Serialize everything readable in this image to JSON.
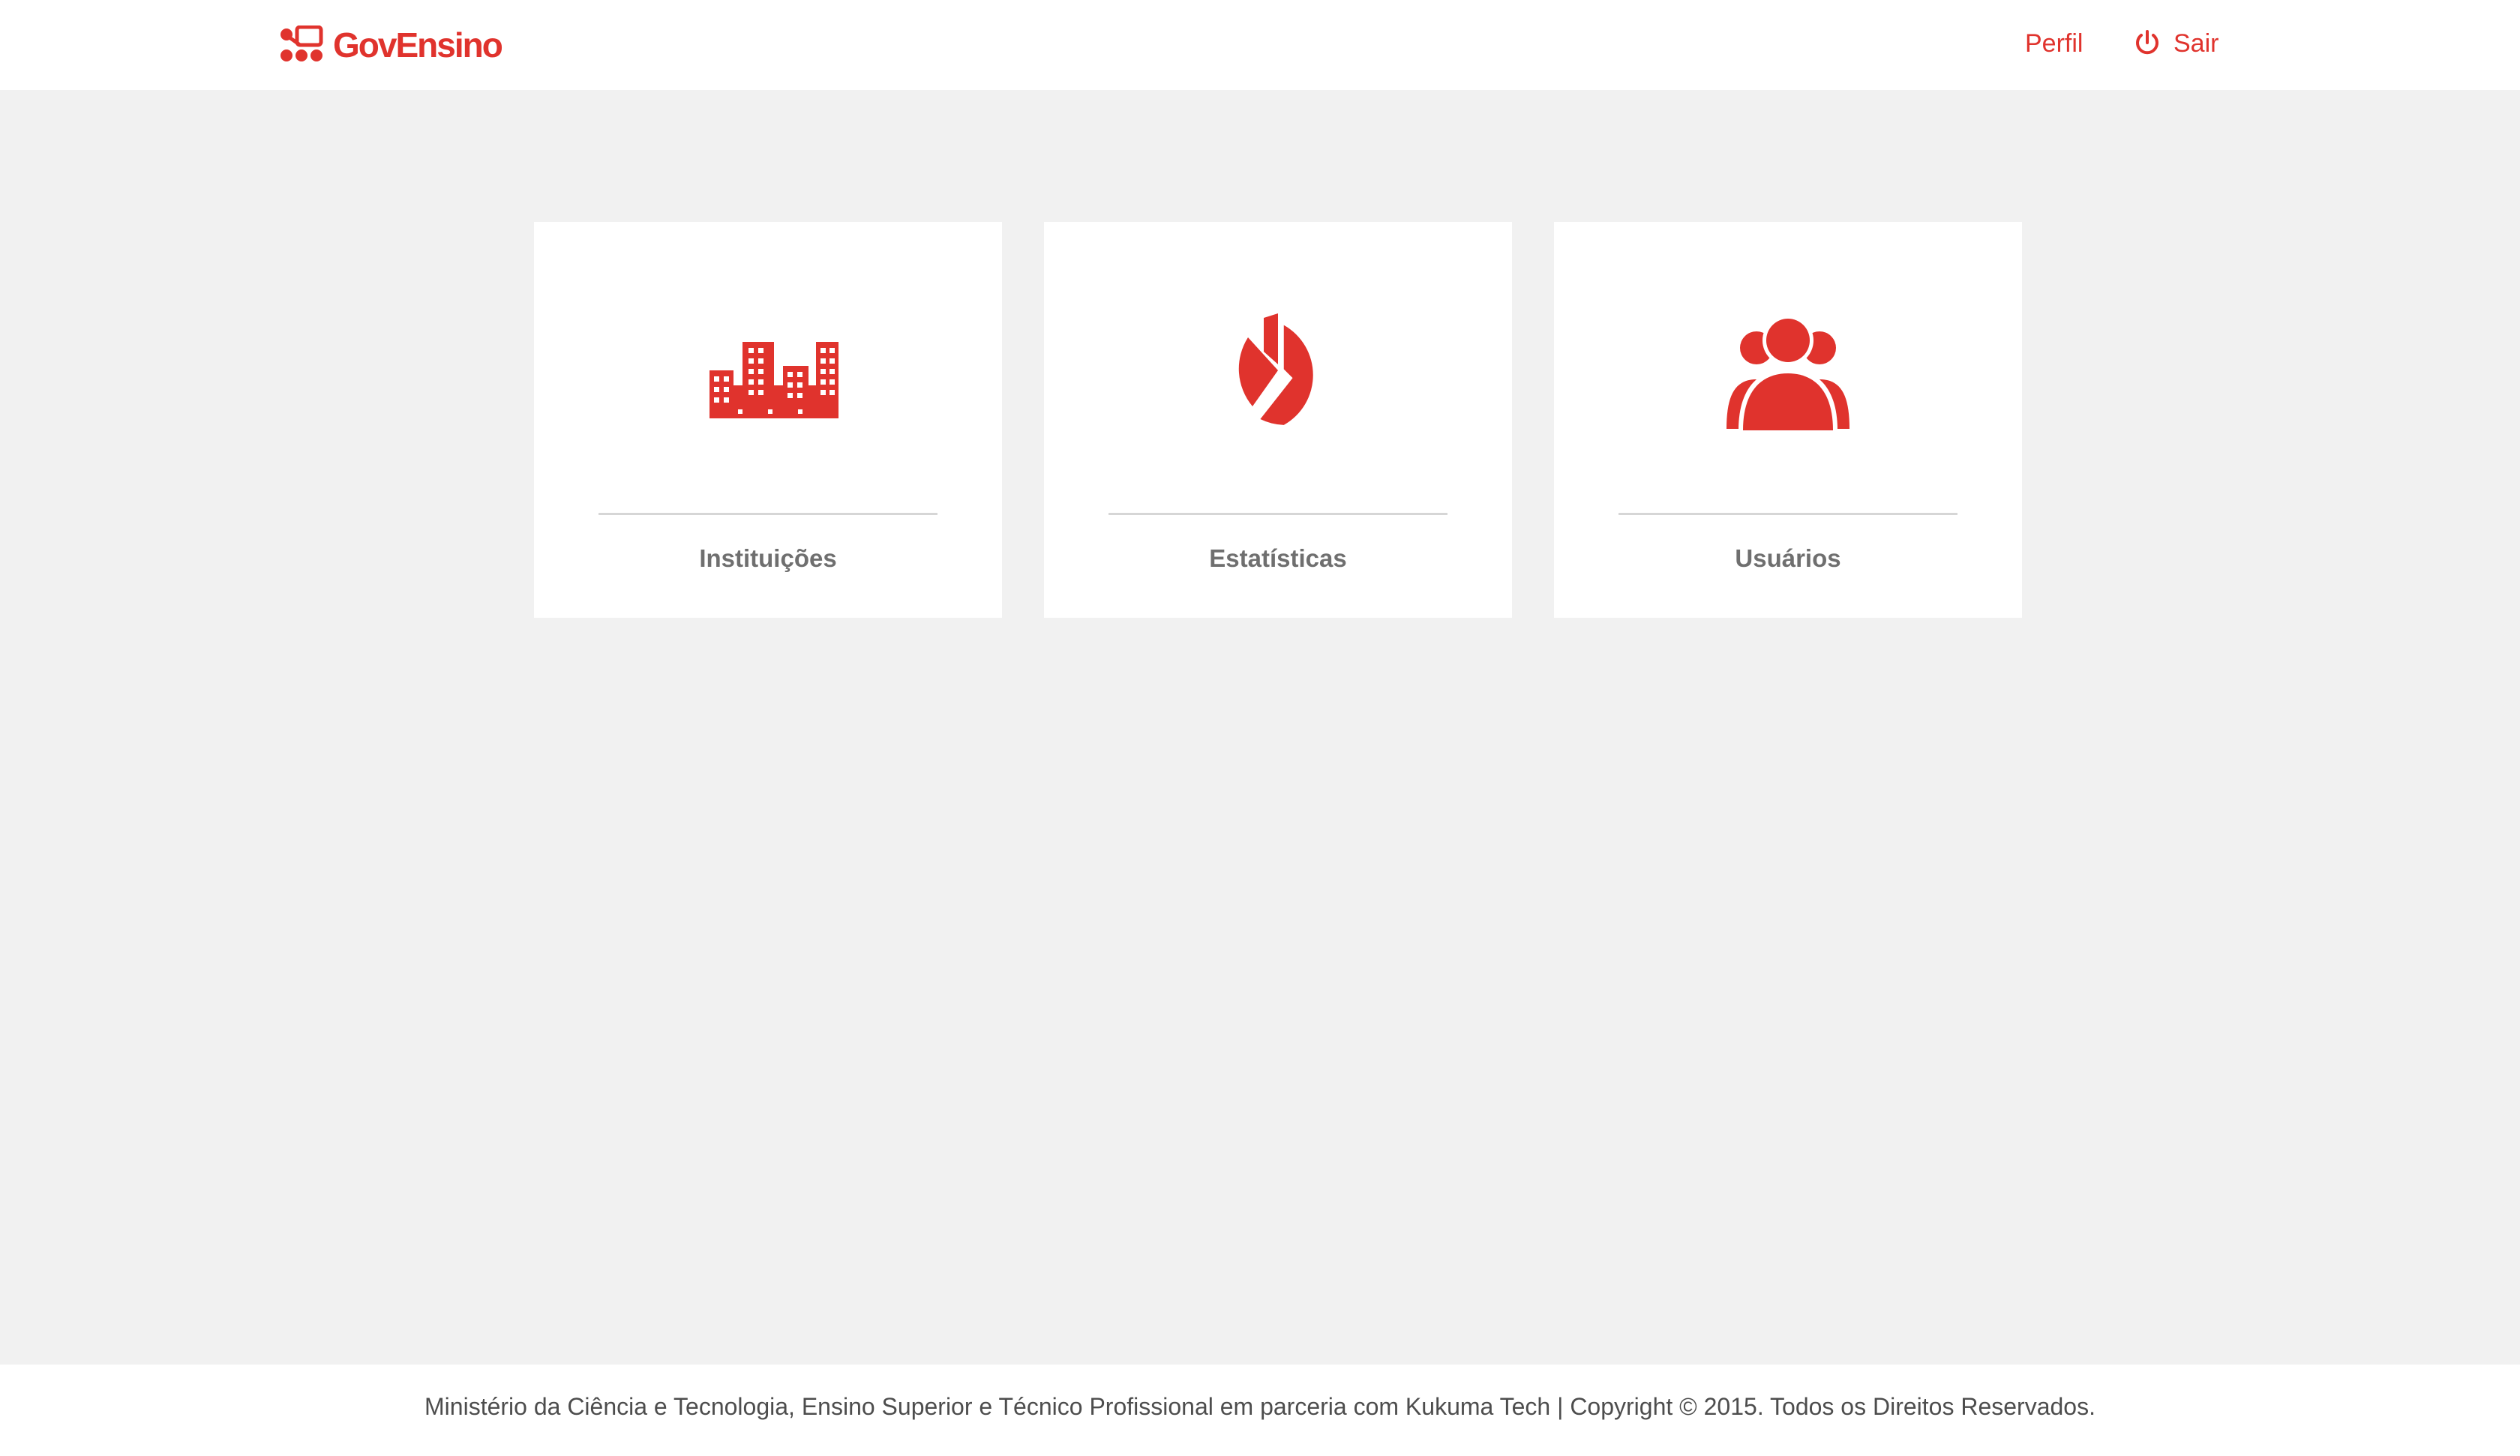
{
  "header": {
    "brand": "GovEnsino",
    "nav": {
      "profile": "Perfil",
      "logout": "Sair"
    }
  },
  "cards": [
    {
      "label": "Instituições",
      "icon": "buildings-icon"
    },
    {
      "label": "Estatísticas",
      "icon": "pie-chart-icon"
    },
    {
      "label": "Usuários",
      "icon": "users-icon"
    }
  ],
  "footer": {
    "text": "Ministério da Ciência e Tecnologia, Ensino Superior e Técnico Profissional em parceria com Kukuma Tech | Copyright © 2015. Todos os Direitos Reservados."
  },
  "colors": {
    "accent": "#e0332d",
    "background": "#f1f1f1",
    "card": "#ffffff",
    "label": "#6f6f6f"
  }
}
